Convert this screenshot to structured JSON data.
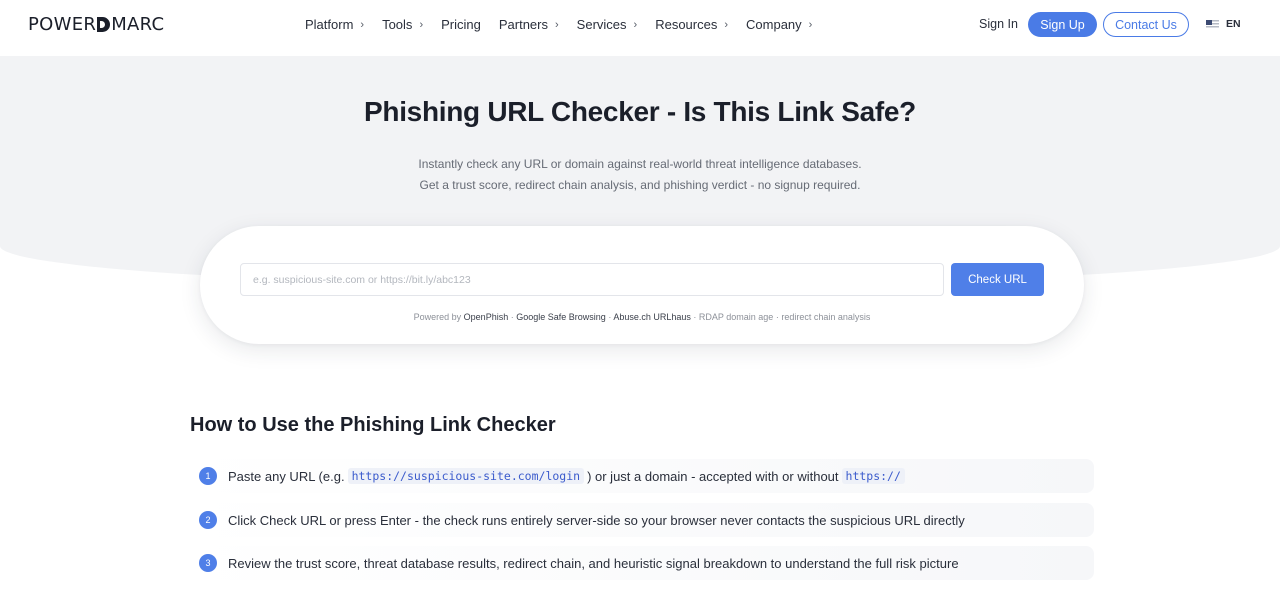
{
  "brand": {
    "logo_left": "POWER",
    "logo_right": "MARC"
  },
  "nav": {
    "items": [
      {
        "label": "Platform",
        "has_menu": true
      },
      {
        "label": "Tools",
        "has_menu": true
      },
      {
        "label": "Pricing",
        "has_menu": false
      },
      {
        "label": "Partners",
        "has_menu": true
      },
      {
        "label": "Services",
        "has_menu": true
      },
      {
        "label": "Resources",
        "has_menu": true
      },
      {
        "label": "Company",
        "has_menu": true
      }
    ],
    "chevron": "›",
    "sign_in": "Sign In",
    "sign_up": "Sign Up",
    "contact": "Contact Us",
    "language": "EN",
    "flag_icon": "us-flag-icon"
  },
  "hero": {
    "title": "Phishing URL Checker - Is This Link Safe?",
    "subtitle_line1": "Instantly check any URL or domain against real-world threat intelligence databases.",
    "subtitle_line2": "Get a trust score, redirect chain analysis, and phishing verdict - no signup required."
  },
  "checker": {
    "input_value": "",
    "placeholder": "e.g. suspicious-site.com or https://bit.ly/abc123",
    "button_label": "Check URL",
    "powered_prefix": "Powered by",
    "source_1": "OpenPhish",
    "sep": "·",
    "source_2": "Google Safe Browsing",
    "source_3": "Abuse.ch URLhaus",
    "extra_1": "RDAP domain age",
    "extra_2": "redirect chain analysis"
  },
  "howto": {
    "title": "How to Use the Phishing Link Checker",
    "steps": [
      {
        "num": "1",
        "text_a": "Paste any URL (e.g.",
        "code_a": "https://suspicious-site.com/login",
        "text_b": ") or just a domain - accepted with or without",
        "code_b": "https://"
      },
      {
        "num": "2",
        "text": "Click Check URL or press Enter - the check runs entirely server-side so your browser never contacts the suspicious URL directly"
      },
      {
        "num": "3",
        "text": "Review the trust score, threat database results, redirect chain, and heuristic signal breakdown to understand the full risk picture"
      }
    ]
  },
  "colors": {
    "accent": "#4a7be6",
    "hero_bg": "#f2f3f5",
    "text_dark": "#1b1f2a",
    "text_muted": "#666b75"
  }
}
